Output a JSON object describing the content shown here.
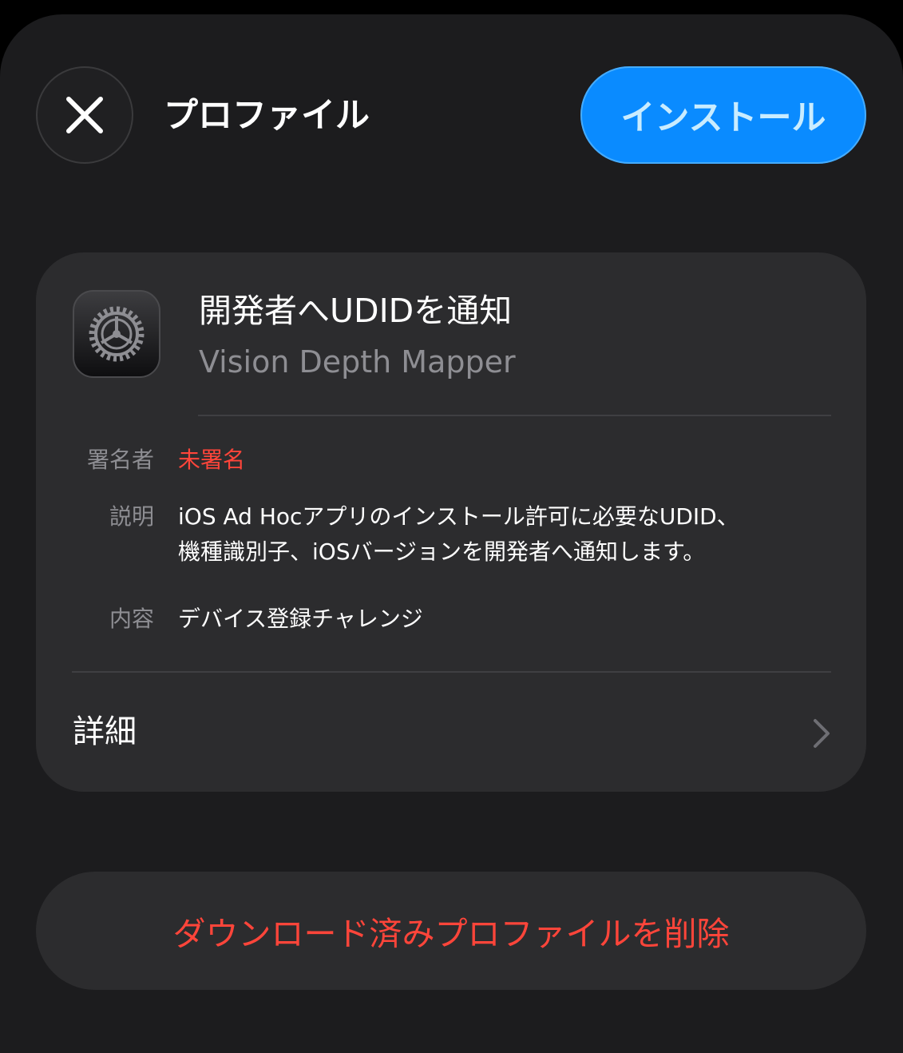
{
  "header": {
    "title": "プロファイル",
    "install_label": "インストール"
  },
  "profile": {
    "name": "開発者へUDIDを通知",
    "subtitle": "Vision Depth Mapper",
    "icon": "gear-icon"
  },
  "info": {
    "signer_label": "署名者",
    "signer_value": "未署名",
    "description_label": "説明",
    "description_line1": "iOS Ad Hocアプリのインストール許可に必要なUDID、",
    "description_line2": "機種識別子、iOSバージョンを開発者へ通知します。",
    "contents_label": "内容",
    "contents_value": "デバイス登録チャレンジ"
  },
  "details": {
    "label": "詳細"
  },
  "actions": {
    "delete_label": "ダウンロード済みプロファイルを削除"
  },
  "colors": {
    "accent": "#0a8bff",
    "destructive": "#ff453a",
    "sheet_background": "#1c1c1e",
    "card_background": "#2c2c2e"
  }
}
